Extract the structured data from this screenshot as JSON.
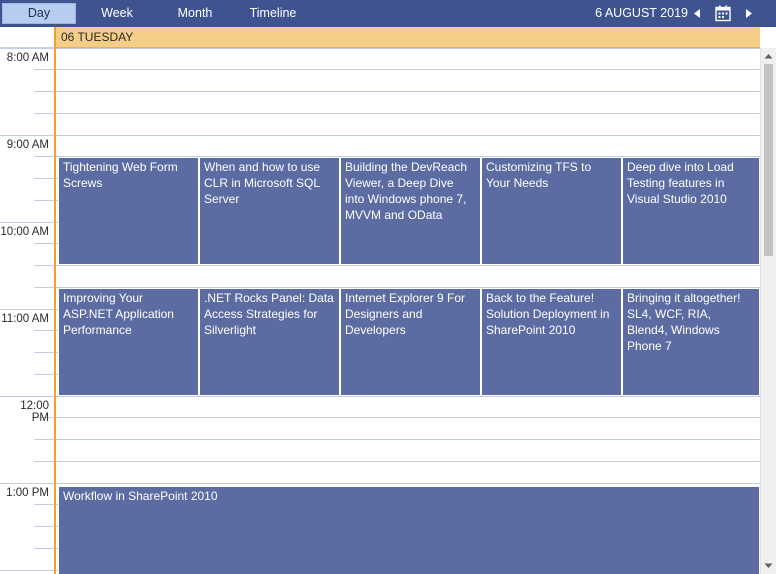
{
  "nav": {
    "views": [
      {
        "label": "Day",
        "active": true
      },
      {
        "label": "Week",
        "active": false
      },
      {
        "label": "Month",
        "active": false
      },
      {
        "label": "Timeline",
        "active": false
      }
    ],
    "current_date": "6 AUGUST 2019",
    "prev_icon": "chevron-left-icon",
    "calendar_icon": "calendar-icon",
    "next_icon": "chevron-right-icon"
  },
  "day_header": {
    "label": "06 TUESDAY"
  },
  "time_labels": [
    "8:00 AM",
    "9:00 AM",
    "10:00 AM",
    "11:00 AM",
    "12:00 PM",
    "1:00 PM"
  ],
  "appointments": [
    {
      "title": "Tightening Web Form Screws"
    },
    {
      "title": "When and how to use CLR in Microsoft SQL Server"
    },
    {
      "title": "Building the DevReach Viewer, a Deep Dive into Windows phone 7, MVVM and OData"
    },
    {
      "title": "Customizing TFS to Your Needs"
    },
    {
      "title": "Deep dive into Load Testing features in Visual Studio 2010"
    },
    {
      "title": "Improving Your ASP.NET Application Performance"
    },
    {
      "title": ".NET Rocks Panel: Data Access Strategies for Silverlight"
    },
    {
      "title": "Internet Explorer 9 For Designers and Developers"
    },
    {
      "title": "Back to the Feature! Solution Deployment in SharePoint 2010"
    },
    {
      "title": "Bringing it altogether! SL4, WCF, RIA, Blend4, Windows Phone 7"
    },
    {
      "title": "Workflow in SharePoint 2010"
    }
  ],
  "colors": {
    "toolbar": "#3f5390",
    "active_tab": "#b7ccef",
    "day_header": "#f4cd86",
    "current_day_accent": "#f0a030",
    "appointment": "#5c6ca3"
  }
}
